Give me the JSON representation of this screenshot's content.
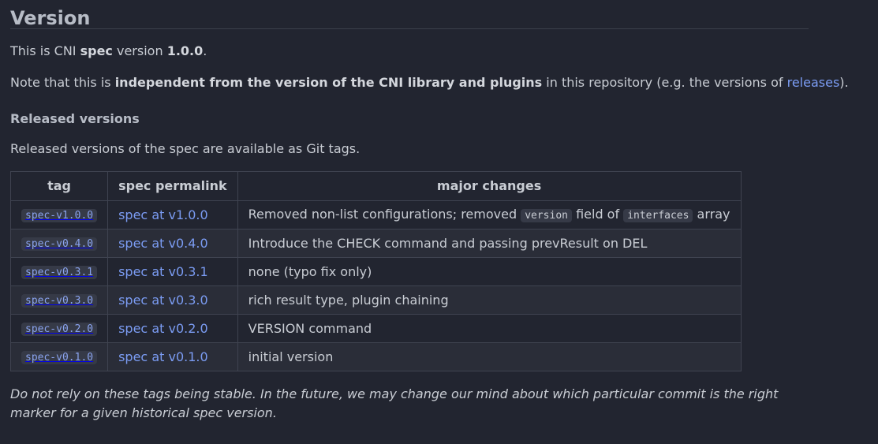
{
  "heading": "Version",
  "intro": {
    "prefix": "This is CNI ",
    "bold_spec": "spec",
    "middle": " version ",
    "bold_version": "1.0.0",
    "suffix": "."
  },
  "note_independent": {
    "prefix": "Note that this is ",
    "bold": "independent from the version of the CNI library and plugins",
    "middle": " in this repository (e.g. the versions of ",
    "link": "releases",
    "suffix": ")."
  },
  "released_heading": "Released versions",
  "released_desc": "Released versions of the spec are available as Git tags.",
  "table": {
    "headers": [
      "tag",
      "spec permalink",
      "major changes"
    ],
    "rows": [
      {
        "tag": "spec-v1.0.0",
        "link": "spec at v1.0.0"
      },
      {
        "tag": "spec-v0.4.0",
        "link": "spec at v0.4.0",
        "change": "Introduce the CHECK command and passing prevResult on DEL"
      },
      {
        "tag": "spec-v0.3.1",
        "link": "spec at v0.3.1",
        "change": "none (typo fix only)"
      },
      {
        "tag": "spec-v0.3.0",
        "link": "spec at v0.3.0",
        "change": "rich result type, plugin chaining"
      },
      {
        "tag": "spec-v0.2.0",
        "link": "spec at v0.2.0",
        "change": "VERSION command"
      },
      {
        "tag": "spec-v0.1.0",
        "link": "spec at v0.1.0",
        "change": "initial version"
      }
    ],
    "row1_change": {
      "part1": "Removed non-list configurations; removed ",
      "code1": "version",
      "part2": " field of ",
      "code2": "interfaces",
      "part3": " array"
    }
  },
  "footnote": "Do not rely on these tags being stable. In the future, we may change our mind about which particular commit is the right marker for a given historical spec version."
}
